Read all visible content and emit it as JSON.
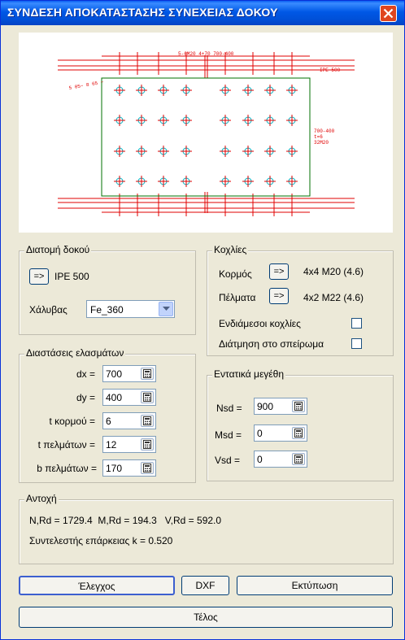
{
  "window": {
    "title": "ΣΥΝΔΕΣΗ ΑΠΟΚΑΤΑΣΤΑΣΗΣ ΣΥΝΕΧΕΙΑΣ ΔΟΚΟΥ"
  },
  "drawing": {
    "dim_top": "5-6M20 4+70 700-400",
    "section_label": "IPE 500",
    "dim_left": "5 05~ 8 65 ~",
    "plate_label_1": "700-400",
    "plate_label_2": "t=6",
    "plate_label_3": "32M20"
  },
  "section_group": {
    "title": "Διατομή δοκού",
    "select_button": "=>",
    "section_value": "IPE 500",
    "steel_label": "Χάλυβας",
    "steel_value": "Fe_360"
  },
  "bolts_group": {
    "title": "Κοχλίες",
    "web_label": "Κορμός",
    "web_button": "=>",
    "web_value": "4x4 M20 (4.6)",
    "flange_label": "Πέλματα",
    "flange_button": "=>",
    "flange_value": "4x2 M22 (4.6)",
    "intermediate_label": "Ενδιάμεσοι κοχλίες",
    "thread_label": "Διάτμηση στο σπείρωμα"
  },
  "plates_group": {
    "title": "Διαστάσεις ελασμάτων",
    "fields": [
      {
        "label": "dx =",
        "value": "700"
      },
      {
        "label": "dy =",
        "value": "400"
      },
      {
        "label": "t κορμού =",
        "value": "6"
      },
      {
        "label": "t πελμάτων =",
        "value": "12"
      },
      {
        "label": "b πελμάτων =",
        "value": "170"
      }
    ]
  },
  "forces_group": {
    "title": "Εντατικά μεγέθη",
    "fields": [
      {
        "label": "Nsd =",
        "value": "900"
      },
      {
        "label": "Msd =",
        "value": "0"
      },
      {
        "label": "Vsd =",
        "value": "0"
      }
    ]
  },
  "resistance_group": {
    "title": "Αντοχή",
    "line1": "N,Rd = 1729.4  M,Rd = 194.3   V,Rd = 592.0",
    "line2": "Συντελεστής επάρκειας k = 0.520"
  },
  "buttons": {
    "check": "Έλεγχος",
    "dxf": "DXF",
    "print": "Εκτύπωση",
    "end": "Τέλος"
  },
  "colors": {
    "titlebar": "#0058E6",
    "window_bg": "#ECE9D8",
    "drawing_red": "#E00000",
    "drawing_green": "#007000",
    "bolt_cyan": "#00B0C0"
  }
}
